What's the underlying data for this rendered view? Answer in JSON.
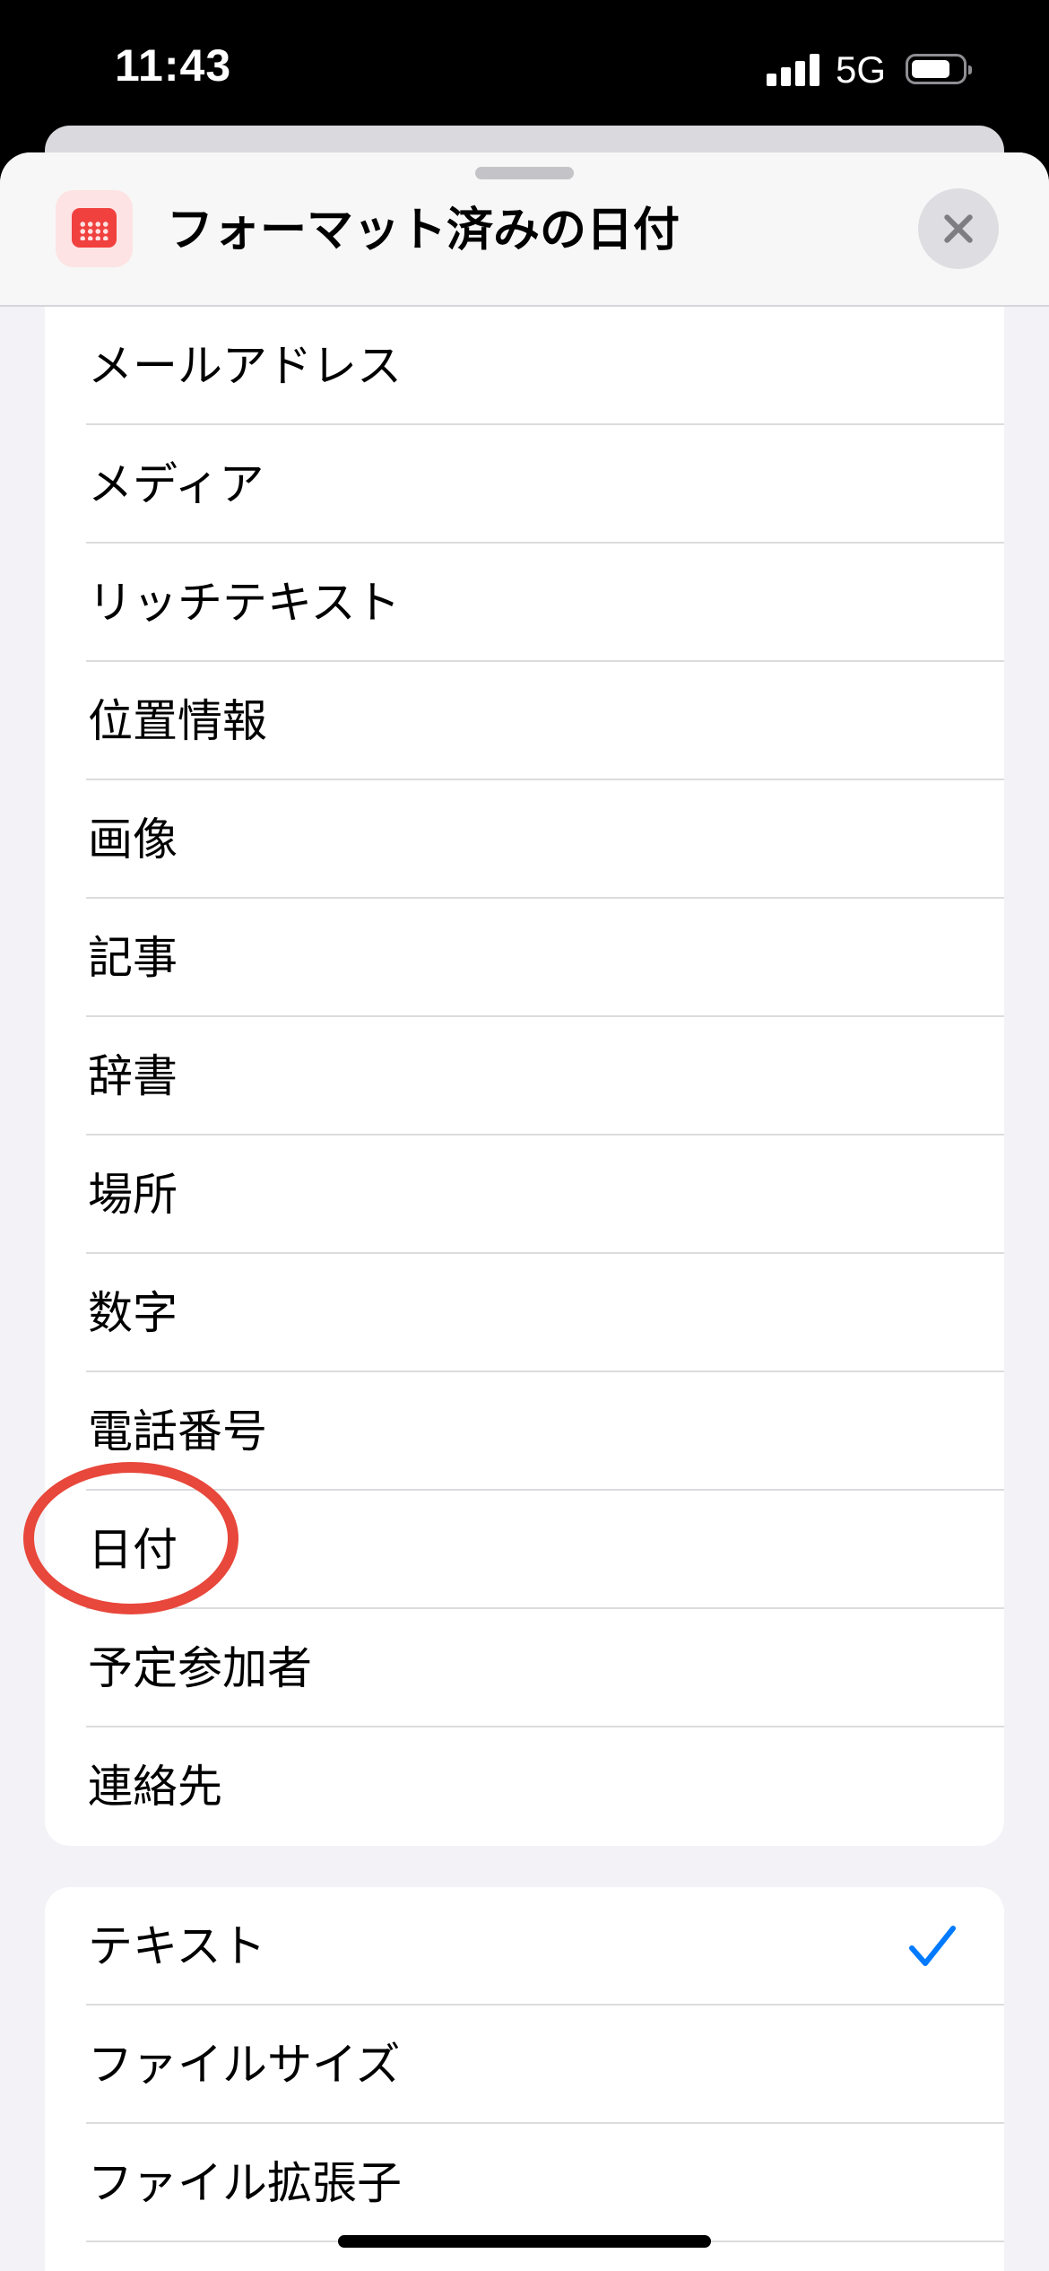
{
  "status_bar": {
    "time": "11:43",
    "network": "5G"
  },
  "header": {
    "title": "フォーマット済みの日付",
    "icon": "calendar-icon"
  },
  "content_types": [
    "メールアドレス",
    "メディア",
    "リッチテキスト",
    "位置情報",
    "画像",
    "記事",
    "辞書",
    "場所",
    "数字",
    "電話番号",
    "日付",
    "予定参加者",
    "連絡先"
  ],
  "output_types": [
    {
      "label": "テキスト",
      "checked": true
    },
    {
      "label": "ファイルサイズ",
      "checked": false
    },
    {
      "label": "ファイル拡張子",
      "checked": false
    }
  ],
  "colors": {
    "accent": "#007aff",
    "highlight_circle": "#e8473b",
    "icon_red": "#f0413f"
  }
}
